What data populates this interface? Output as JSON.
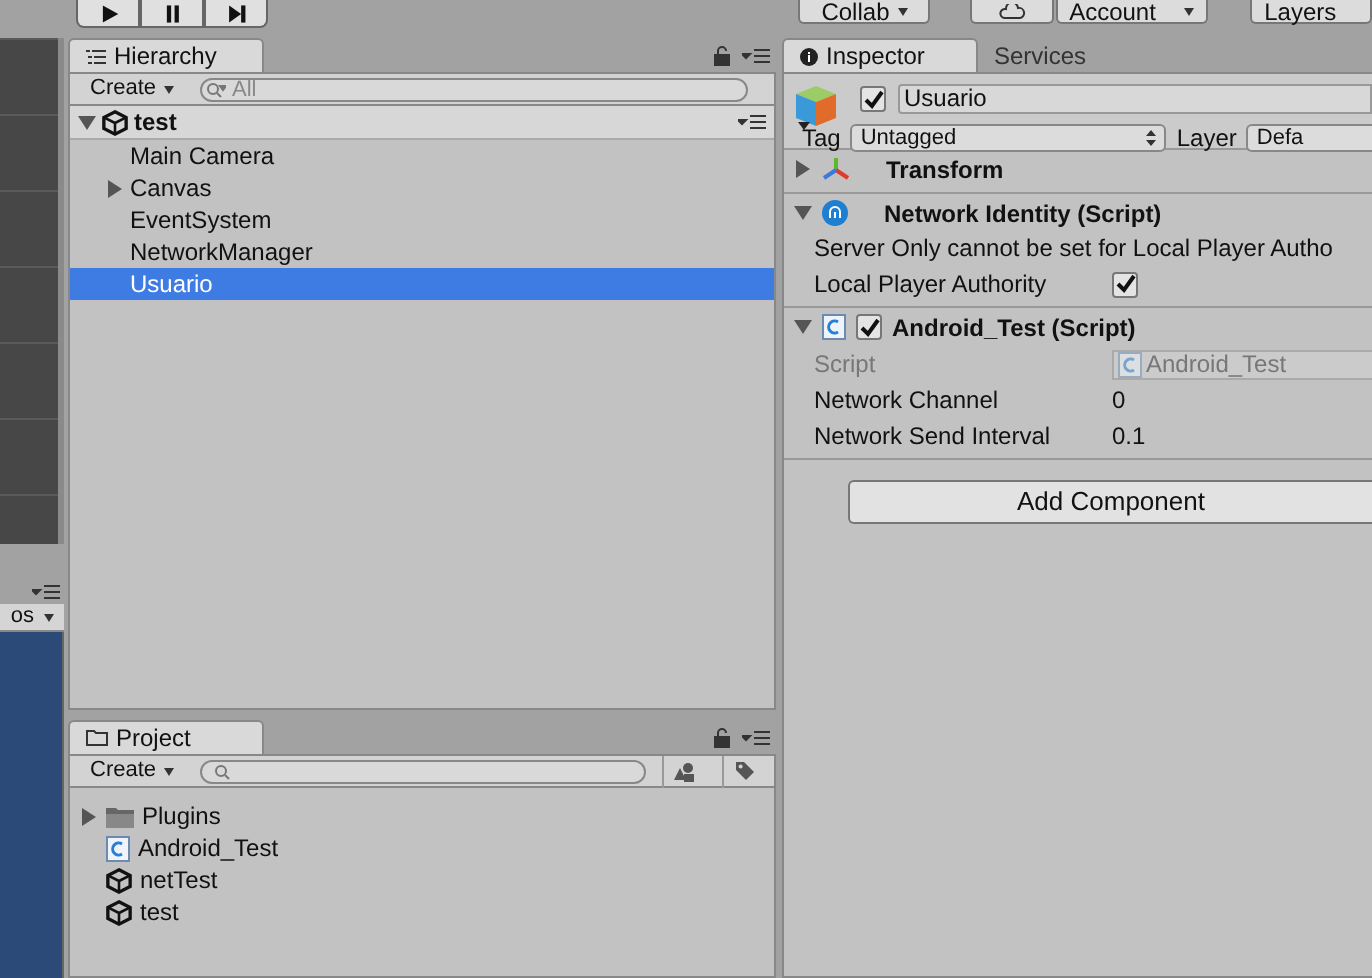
{
  "toolbar": {
    "play_controls": [
      {
        "kind": "play"
      },
      {
        "kind": "pause"
      },
      {
        "kind": "step"
      }
    ],
    "collab": "Collab",
    "account": "Account",
    "layers": "Layers"
  },
  "left_panel": {
    "dropdown": "os"
  },
  "hierarchy": {
    "tab": "Hierarchy",
    "create": "Create",
    "search": {
      "placeholder": "All"
    },
    "scene": {
      "name": "test",
      "expanded": true
    },
    "items": [
      {
        "name": "Main Camera",
        "expandable": false,
        "selected": false
      },
      {
        "name": "Canvas",
        "expandable": true,
        "selected": false
      },
      {
        "name": "EventSystem",
        "expandable": false,
        "selected": false
      },
      {
        "name": "NetworkManager",
        "expandable": false,
        "selected": false
      },
      {
        "name": "Usuario",
        "expandable": false,
        "selected": true
      }
    ]
  },
  "inspector": {
    "tabs": [
      {
        "label": "Inspector",
        "selected": true
      },
      {
        "label": "Services",
        "selected": false
      }
    ],
    "object": {
      "active": true,
      "name": "Usuario",
      "tag_label": "Tag",
      "tag": "Untagged",
      "layer_label": "Layer",
      "layer": "Defa"
    },
    "components": [
      {
        "kind": "transform",
        "title": "Transform",
        "expanded": false
      },
      {
        "kind": "network",
        "title": "Network Identity (Script)",
        "expanded": true,
        "message": "Server Only cannot be set for Local Player Autho",
        "fields": [
          {
            "label": "Local Player Authority",
            "kind": "checkbox",
            "checked": true
          }
        ]
      },
      {
        "kind": "script",
        "title": "Android_Test (Script)",
        "expanded": true,
        "enabled": true,
        "fields": [
          {
            "label": "Script",
            "kind": "object",
            "value": "Android_Test",
            "disabled": true
          },
          {
            "label": "Network Channel",
            "kind": "text",
            "value": "0",
            "disabled": false
          },
          {
            "label": "Network Send Interval",
            "kind": "text",
            "value": "0.1",
            "disabled": false
          }
        ]
      }
    ],
    "add_component": "Add Component"
  },
  "project": {
    "tab": "Project",
    "create": "Create",
    "items": [
      {
        "name": "Plugins",
        "kind": "folder"
      },
      {
        "name": "Android_Test",
        "kind": "script"
      },
      {
        "name": "netTest",
        "kind": "scene"
      },
      {
        "name": "test",
        "kind": "scene"
      }
    ]
  }
}
